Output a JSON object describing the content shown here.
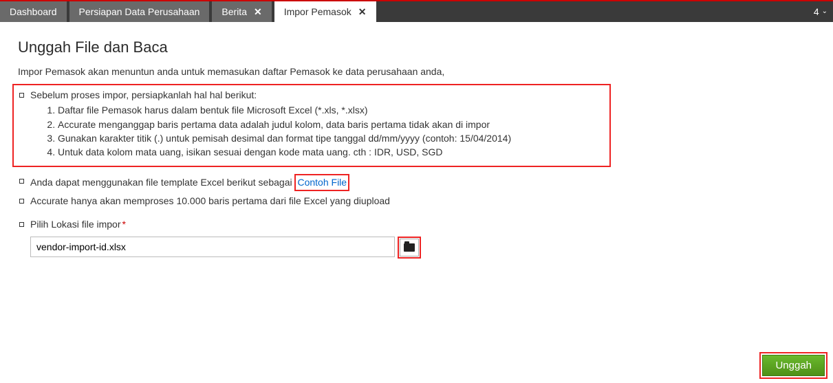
{
  "tabs": [
    {
      "label": "Dashboard",
      "closable": false
    },
    {
      "label": "Persiapan Data Perusahaan",
      "closable": false
    },
    {
      "label": "Berita",
      "closable": true
    },
    {
      "label": "Impor Pemasok",
      "closable": true,
      "active": true
    }
  ],
  "notif_count": "4",
  "page": {
    "title": "Unggah File dan Baca",
    "intro": "Impor Pemasok akan menuntun anda untuk memasukan daftar Pemasok ke data perusahaan anda,",
    "prep_heading": "Sebelum proses impor, persiapkanlah hal hal berikut:",
    "prep_items": [
      "Daftar file Pemasok harus dalam bentuk file Microsoft Excel (*.xls, *.xlsx)",
      "Accurate menganggap baris pertama data adalah judul kolom, data baris pertama tidak akan di impor",
      "Gunakan karakter titik (.) untuk pemisah desimal dan format tipe tanggal dd/mm/yyyy (contoh: 15/04/2014)",
      "Untuk data kolom mata uang, isikan sesuai dengan kode mata uang. cth : IDR, USD, SGD"
    ],
    "template_prefix": "Anda dapat menggunakan file template Excel berikut sebagai ",
    "template_link": "Contoh File",
    "limit_note": "Accurate hanya akan memproses 10.000 baris pertama dari file Excel yang diupload",
    "file_label": "Pilih Lokasi file impor",
    "file_value": "vendor-import-id.xlsx",
    "upload_label": "Unggah"
  }
}
